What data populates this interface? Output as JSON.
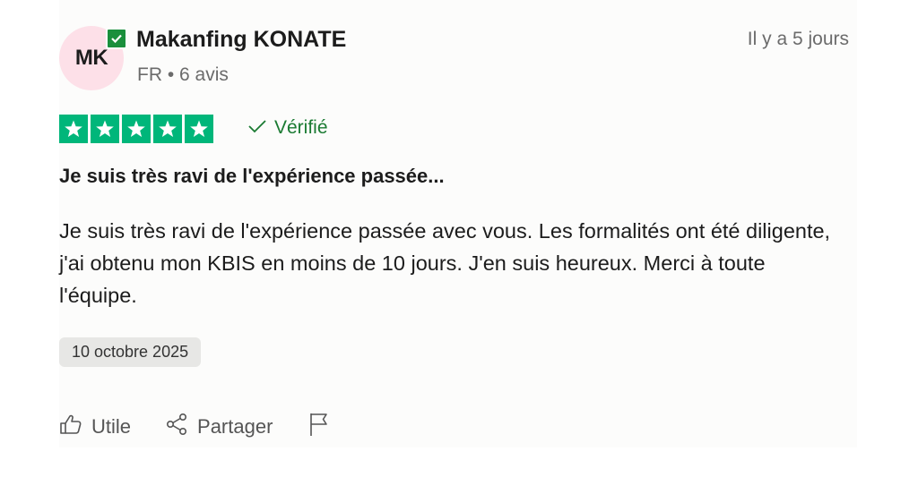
{
  "review": {
    "author": {
      "initials": "MK",
      "name": "Makanfing KONATE",
      "meta": "FR • 6 avis"
    },
    "time_ago": "Il y a 5 jours",
    "rating": 5,
    "rating_max": 5,
    "verified_label": "Vérifié",
    "title": "Je suis très ravi de l'expérience passée...",
    "body": "Je suis très ravi de l'expérience passée avec vous. Les formalités ont été diligente, j'ai obtenu mon KBIS en moins de 10 jours. J'en suis heureux. Merci à toute l'équipe.",
    "date": "10 octobre 2025"
  },
  "actions": {
    "useful_label": "Utile",
    "share_label": "Partager"
  },
  "colors": {
    "star_green": "#00b67a",
    "verified_green": "#1a7a32",
    "avatar_bg": "#fde0e8",
    "badge_green": "#1a8f3c"
  }
}
